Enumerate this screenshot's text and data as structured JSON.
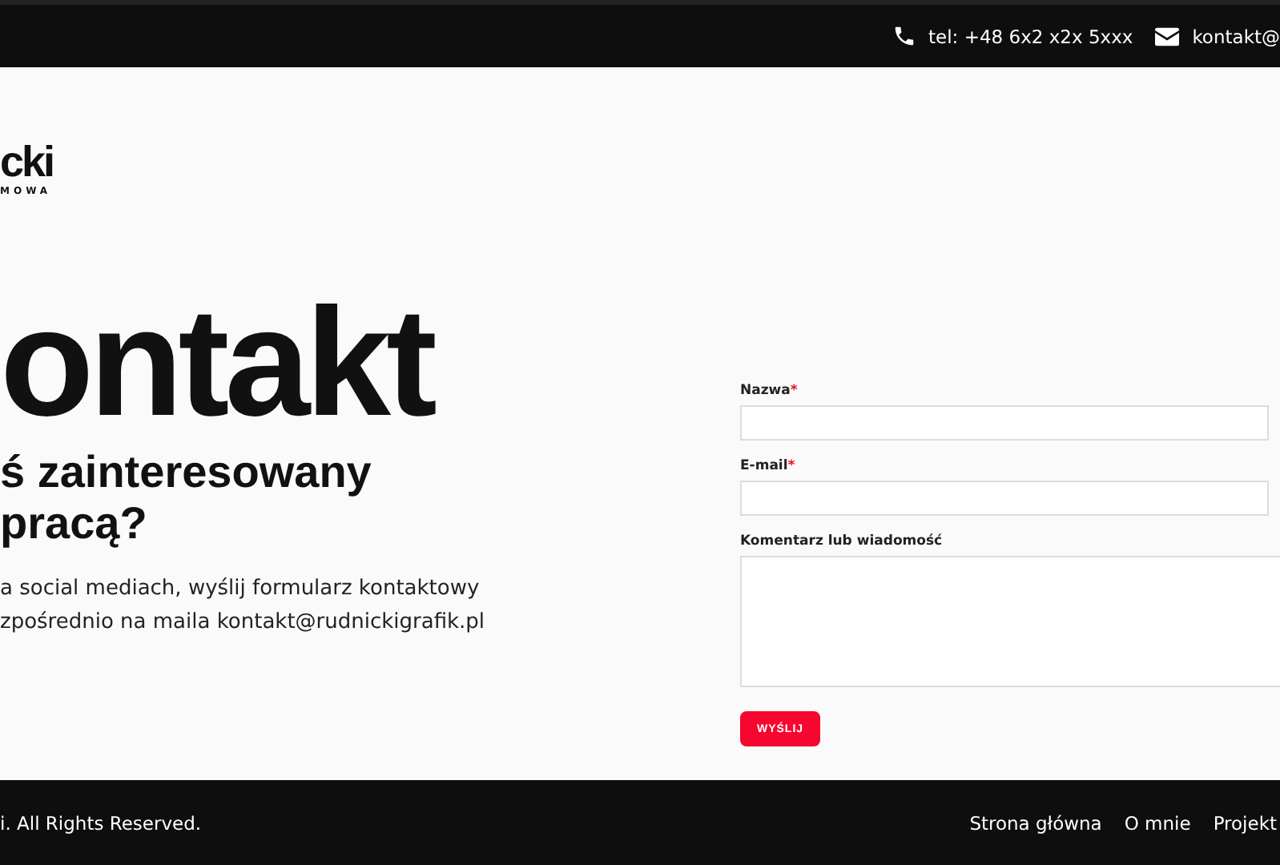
{
  "top_bar": {
    "phone": "tel: +48 6x2 x2x 5xxx",
    "email": "kontakt@"
  },
  "logo": {
    "name": "cki",
    "tagline": "MOWA"
  },
  "heading": "ontakt",
  "subheading_lines": [
    "ś zainteresowany",
    "pracą?"
  ],
  "intro_lines": [
    "a social mediach, wyślij formularz kontaktowy",
    "zpośrednio na maila kontakt@rudnickigrafik.pl"
  ],
  "form": {
    "fields": [
      {
        "label": "Nazwa",
        "required": true,
        "kind": "input"
      },
      {
        "label": "E-mail",
        "required": true,
        "kind": "input"
      },
      {
        "label": "Komentarz lub wiadomość",
        "required": false,
        "kind": "textarea"
      }
    ],
    "required_mark": "*",
    "submit": "WYŚLIJ"
  },
  "footer": {
    "copyright": "i. All Rights Reserved.",
    "links": [
      "Strona główna",
      "O mnie",
      "Projekt"
    ]
  }
}
